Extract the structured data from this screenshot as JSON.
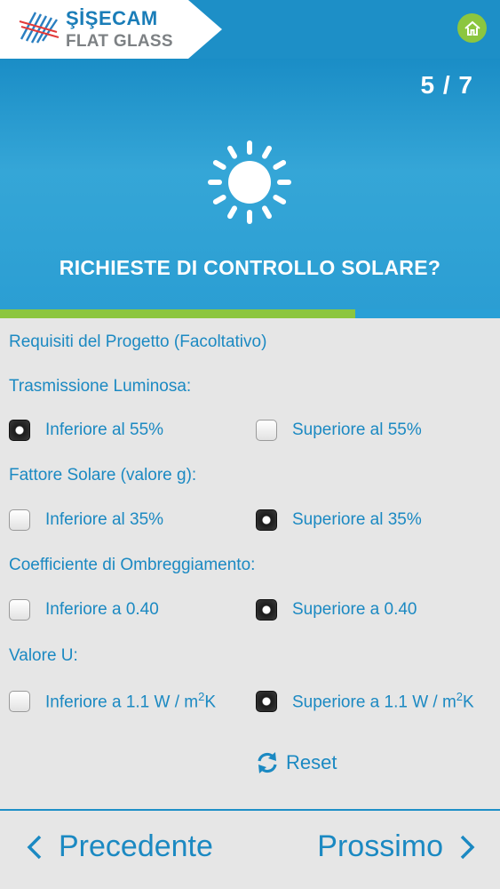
{
  "header": {
    "brand_line1": "ŞİŞECAM",
    "brand_line2": "FLAT GLASS",
    "home_icon": "home-icon",
    "colors": {
      "bar": "#1d8fc7",
      "accent": "#8cc63f"
    }
  },
  "hero": {
    "step": "5 / 7",
    "icon": "sun-icon",
    "title": "RICHIESTE DI CONTROLLO SOLARE?",
    "progress_percent": 71
  },
  "form": {
    "intro": "Requisiti del Progetto (Facoltativo)",
    "groups": [
      {
        "label": "Trasmissione Luminosa:",
        "options": [
          {
            "text": "Inferiore al 55%",
            "selected": true
          },
          {
            "text": "Superiore al 55%",
            "selected": false
          }
        ]
      },
      {
        "label": "Fattore Solare (valore g):",
        "options": [
          {
            "text": "Inferiore al 35%",
            "selected": false
          },
          {
            "text": "Superiore al 35%",
            "selected": true
          }
        ]
      },
      {
        "label": "Coefficiente di Ombreggiamento:",
        "options": [
          {
            "text": "Inferiore a 0.40",
            "selected": false
          },
          {
            "text": "Superiore a 0.40",
            "selected": true
          }
        ]
      },
      {
        "label": "Valore U:",
        "options": [
          {
            "text_pre": "Inferiore a 1.1 W / m",
            "sup": "2",
            "text_post": "K",
            "selected": false
          },
          {
            "text_pre": "Superiore a 1.1 W / m",
            "sup": "2",
            "text_post": "K",
            "selected": true
          }
        ]
      }
    ],
    "reset_label": "Reset"
  },
  "footer": {
    "prev_label": "Precedente",
    "next_label": "Prossimo"
  }
}
